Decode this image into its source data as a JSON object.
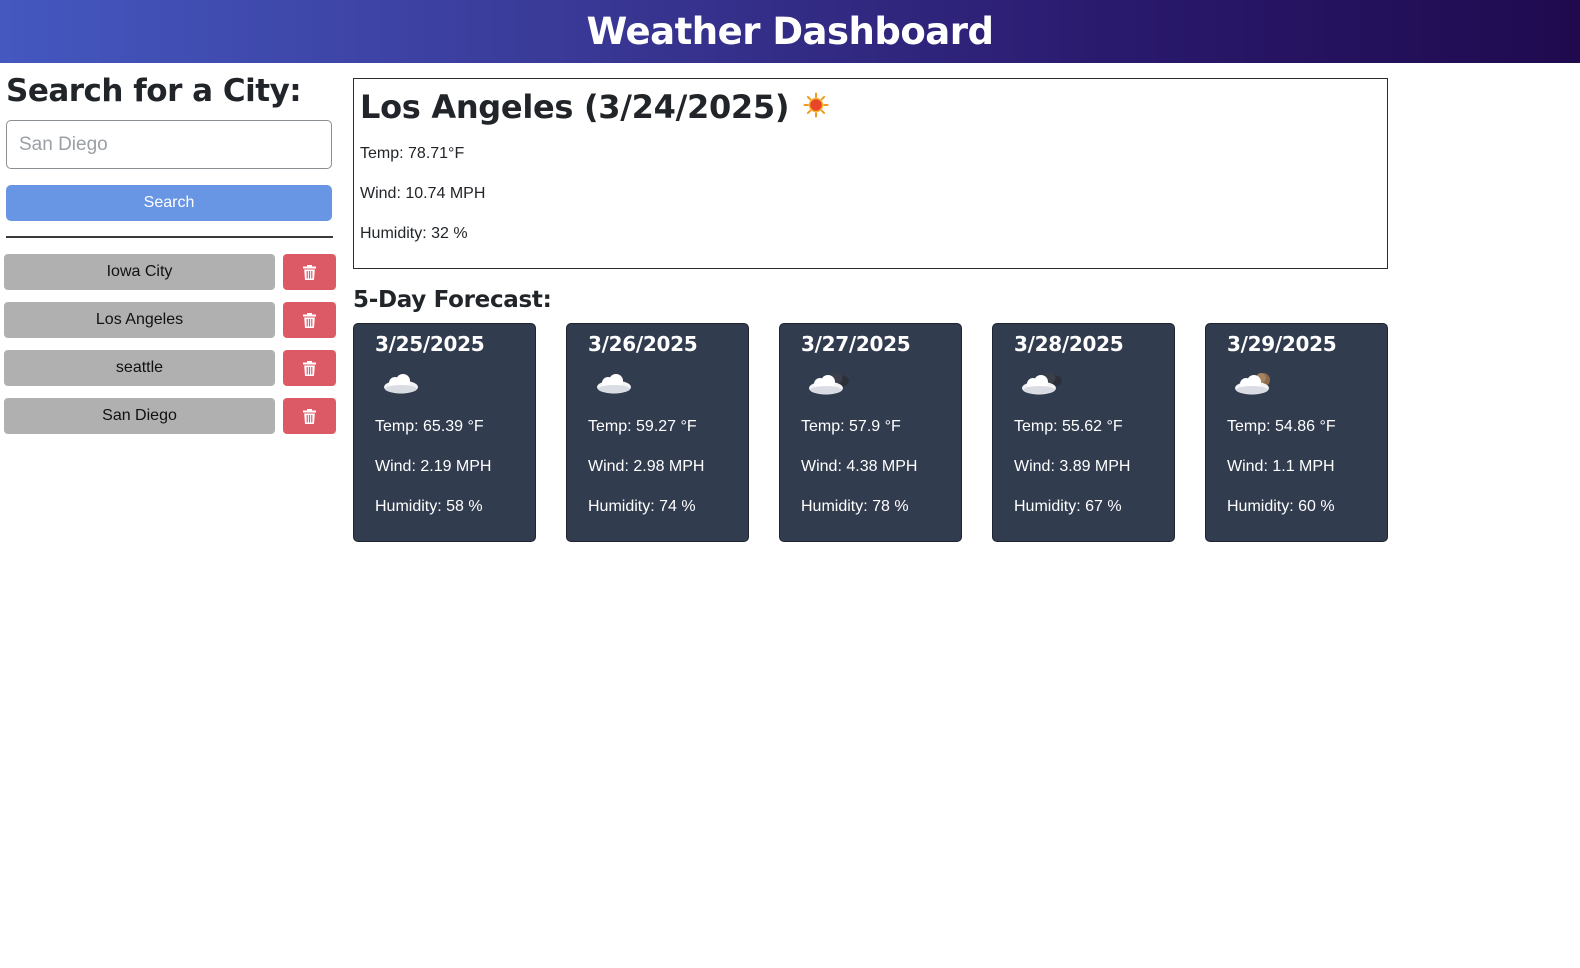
{
  "header": {
    "title": "Weather Dashboard"
  },
  "sidebar": {
    "heading": "Search for a City:",
    "search_placeholder": "San Diego",
    "search_button": "Search",
    "history": [
      {
        "label": "Iowa City",
        "delete_icon": "trash-icon"
      },
      {
        "label": "Los Angeles",
        "delete_icon": "trash-icon"
      },
      {
        "label": "seattle",
        "delete_icon": "trash-icon"
      },
      {
        "label": "San Diego",
        "delete_icon": "trash-icon"
      }
    ]
  },
  "today": {
    "title": "Los Angeles (3/24/2025)",
    "icon": "sun-icon",
    "temp": "Temp: 78.71°F",
    "wind": "Wind: 10.74 MPH",
    "humidity": "Humidity: 32 %"
  },
  "forecast": {
    "title": "5-Day Forecast:",
    "days": [
      {
        "date": "3/25/2025",
        "icon": "cloud-icon",
        "temp": "Temp: 65.39 °F",
        "wind": "Wind: 2.19 MPH",
        "humidity": "Humidity: 58 %"
      },
      {
        "date": "3/26/2025",
        "icon": "cloud-icon",
        "temp": "Temp: 59.27 °F",
        "wind": "Wind: 2.98 MPH",
        "humidity": "Humidity: 74 %"
      },
      {
        "date": "3/27/2025",
        "icon": "cloud-dark-icon",
        "temp": "Temp: 57.9 °F",
        "wind": "Wind: 4.38 MPH",
        "humidity": "Humidity: 78 %"
      },
      {
        "date": "3/28/2025",
        "icon": "cloud-dark-icon",
        "temp": "Temp: 55.62 °F",
        "wind": "Wind: 3.89 MPH",
        "humidity": "Humidity: 67 %"
      },
      {
        "date": "3/29/2025",
        "icon": "cloud-brown-icon",
        "temp": "Temp: 54.86 °F",
        "wind": "Wind: 1.1 MPH",
        "humidity": "Humidity: 60 %"
      }
    ]
  },
  "colors": {
    "header_start": "#4458c0",
    "header_end": "#1f0a4e",
    "search_button": "#6895e4",
    "history_button": "#b0b0b0",
    "delete_button": "#dc5a66",
    "card_bg": "#323c4f"
  }
}
